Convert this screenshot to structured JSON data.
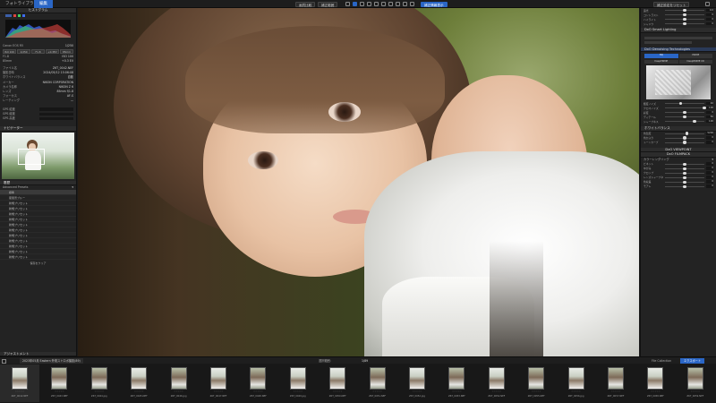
{
  "tabs": [
    {
      "label": "フォトライブラリ",
      "active": false
    },
    {
      "label": "編集",
      "active": true
    }
  ],
  "toolbar": {
    "compare_label": "画質比較",
    "range_label": "補正範囲",
    "correction_label": "補正情報表示",
    "history_label": "補正履歴",
    "soft_proof_label": "補正設定をリセット",
    "zoom_value": "100%"
  },
  "left_panel": {
    "histogram_title": "ヒストグラム",
    "info_rows": [
      {
        "label": "Canon EOS R5",
        "value": "1/250"
      },
      {
        "label": "F1.8",
        "value": "ISO 100"
      },
      {
        "label": "85mm",
        "value": "+0.3 EV"
      }
    ],
    "buttons": [
      "ISO 100",
      "1/250",
      "F1.8",
      "+0.3EV",
      "85mm"
    ],
    "meta_rows": [
      {
        "label": "ファイル名",
        "value": "Z6T_0042.NEF"
      },
      {
        "label": "撮影日時",
        "value": "2024/05/12 15:06:08"
      },
      {
        "label": "ホワイトバランス",
        "value": "自動"
      },
      {
        "label": "メーカー",
        "value": "NIKON CORPORATION"
      },
      {
        "label": "カメラ名称",
        "value": "NIKON Z 6"
      },
      {
        "label": "レンズ",
        "value": "85mm f/1.8"
      },
      {
        "label": "フォーカス",
        "value": "AF-S"
      },
      {
        "label": "レーティング",
        "value": "—"
      }
    ],
    "gps_rows": [
      {
        "label": "GPS 緯度",
        "value": ""
      },
      {
        "label": "GPS 経度",
        "value": ""
      },
      {
        "label": "GPS 高度",
        "value": ""
      }
    ],
    "navigator_title": "ナビゲーター",
    "presets_title": "履歴",
    "presets_sub": "Advanced Presets",
    "preset_items": [
      "標準",
      "夏風景ブルー",
      "新規プリセット",
      "新規プリセット",
      "新規プリセット",
      "新規プリセット",
      "新規プリセット",
      "新規プリセット",
      "新規プリセット",
      "新規プリセット",
      "新規プリセット",
      "新規プリセット",
      "新規プリセット"
    ],
    "footer_btn": "保存をクリア",
    "bottom_section": "アジャストメント"
  },
  "right_panel": {
    "sections": [
      {
        "title": "DxO Smart Lighting"
      },
      {
        "title": "DxO Denoising Technologies"
      },
      {
        "title": "ホワイトバランス"
      },
      {
        "title": "DxO VIEWPOINT"
      },
      {
        "title": "DxO FILMPACK"
      }
    ],
    "denoise_modes": [
      "HQ",
      "PRIME",
      "DeepPRIME",
      "DeepPRIME XD"
    ],
    "sliders_top": [
      {
        "label": "露光",
        "value": "0.0",
        "pos": 0.5
      },
      {
        "label": "コントラスト",
        "value": "0",
        "pos": 0.5
      },
      {
        "label": "ハイライト",
        "value": "0",
        "pos": 0.5
      },
      {
        "label": "シャドウ",
        "value": "0",
        "pos": 0.5
      }
    ],
    "sliders_mid": [
      {
        "label": "輝度ノイズ",
        "value": "40",
        "pos": 0.4
      },
      {
        "label": "クロマノイズ",
        "value": "100",
        "pos": 1.0
      },
      {
        "label": "彩度",
        "value": "0",
        "pos": 0.5
      },
      {
        "label": "ディテール",
        "value": "50",
        "pos": 0.5
      },
      {
        "label": "シャープネス",
        "value": "100",
        "pos": 0.75
      }
    ],
    "sliders_wb": [
      {
        "label": "色温度",
        "value": "5200",
        "pos": 0.55
      },
      {
        "label": "色かぶり",
        "value": "0",
        "pos": 0.5
      },
      {
        "label": "トーンカーブ",
        "value": "0",
        "pos": 0.5
      }
    ],
    "sliders_bottom": [
      {
        "label": "ビネット",
        "value": "0",
        "pos": 0.5
      },
      {
        "label": "ゆがみ",
        "value": "0",
        "pos": 0.5
      },
      {
        "label": "クロップ",
        "value": "0",
        "pos": 0.5
      },
      {
        "label": "レンズシャープネス",
        "value": "0",
        "pos": 0.5
      },
      {
        "label": "色収差",
        "value": "0",
        "pos": 0.5
      },
      {
        "label": "モアレ",
        "value": "0",
        "pos": 0.5
      }
    ],
    "filmpack_label": "カラーレンダリング"
  },
  "filmbar": {
    "path": "2023年05月 Eastern 外苑ストロボ撮影(89)",
    "count": "選択範囲：",
    "sort": "1/89",
    "collection": "File Collection",
    "export_btn": "エクスポート"
  },
  "filmstrip": [
    {
      "name": "Z6T_0042.NEF",
      "tone": "light"
    },
    {
      "name": "Z6T_0043.NEF",
      "tone": "mid"
    },
    {
      "name": "Z6T_0044.jpg",
      "tone": "mid"
    },
    {
      "name": "Z6T_0045.NEF",
      "tone": "light"
    },
    {
      "name": "Z6T_0046.jpg",
      "tone": "mid"
    },
    {
      "name": "Z6T_0047.NEF",
      "tone": "light"
    },
    {
      "name": "Z6T_0048.NEF",
      "tone": "mid"
    },
    {
      "name": "Z6T_0049.jpg",
      "tone": "light"
    },
    {
      "name": "Z6T_0050.NEF",
      "tone": "light"
    },
    {
      "name": "Z6T_0051.NEF",
      "tone": "mid"
    },
    {
      "name": "Z6T_0052.jpg",
      "tone": "light"
    },
    {
      "name": "Z6T_0053.NEF",
      "tone": "mid"
    },
    {
      "name": "Z6T_0054.NEF",
      "tone": "light"
    },
    {
      "name": "Z6T_0055.NEF",
      "tone": "mid"
    },
    {
      "name": "Z6T_0056.jpg",
      "tone": "light"
    },
    {
      "name": "Z6T_0057.NEF",
      "tone": "mid"
    },
    {
      "name": "Z6T_0058.NEF",
      "tone": "light"
    },
    {
      "name": "Z6T_0059.NEF",
      "tone": "mid"
    }
  ],
  "colors": {
    "accent": "#2a66c6",
    "panel": "#232323",
    "histogram_red": "#e0443f",
    "histogram_green": "#3fcf5a",
    "histogram_blue": "#3d6cf0"
  }
}
